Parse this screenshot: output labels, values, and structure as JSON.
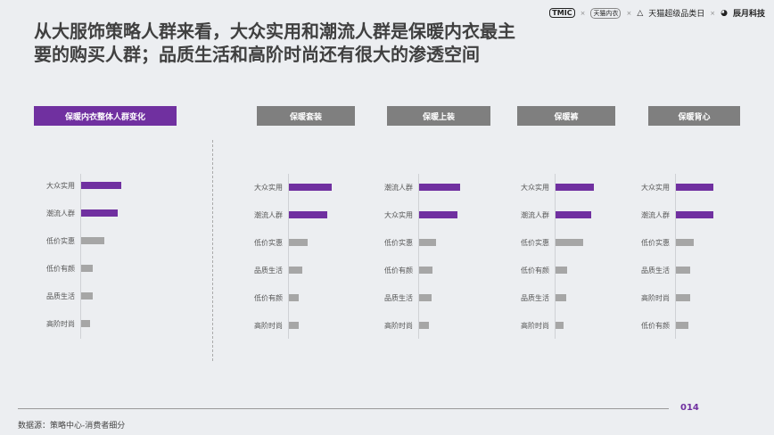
{
  "title_line1": "从大服饰策略人群来看，大众实用和潮流人群是保暖内衣最主",
  "title_line2": "要的购买人群；品质生活和高阶时尚还有很大的渗透空间",
  "logos": {
    "tmic": "TMIC",
    "brand1": "天猫内衣",
    "brand2": "天猫超级品类日",
    "brand3": "辰月科技",
    "sep": "×"
  },
  "page_number": "014",
  "source": "数据源：策略中心-消费者细分",
  "colors": {
    "highlight": "#7030a0",
    "normal": "#a6a6a6",
    "header_gray": "#7f7f7f"
  },
  "chart_data": [
    {
      "type": "bar",
      "title": "保暖内衣整体人群变化",
      "categories": [
        "大众实用",
        "潮流人群",
        "低价实惠",
        "低价有颜",
        "品质生活",
        "高阶时尚"
      ],
      "values": [
        45,
        41,
        26,
        13,
        13,
        10
      ],
      "highlight": [
        true,
        true,
        false,
        false,
        false,
        false
      ]
    },
    {
      "type": "bar",
      "title": "保暖套装",
      "categories": [
        "大众实用",
        "潮流人群",
        "低价实惠",
        "品质生活",
        "低价有颜",
        "高阶时尚"
      ],
      "values": [
        48,
        43,
        21,
        15,
        11,
        11
      ],
      "highlight": [
        true,
        true,
        false,
        false,
        false,
        false
      ]
    },
    {
      "type": "bar",
      "title": "保暖上装",
      "categories": [
        "潮流人群",
        "大众实用",
        "低价实惠",
        "低价有颜",
        "品质生活",
        "高阶时尚"
      ],
      "values": [
        46,
        43,
        19,
        15,
        14,
        11
      ],
      "highlight": [
        true,
        true,
        false,
        false,
        false,
        false
      ]
    },
    {
      "type": "bar",
      "title": "保暖裤",
      "categories": [
        "大众实用",
        "潮流人群",
        "低价实惠",
        "低价有颜",
        "品质生活",
        "高阶时尚"
      ],
      "values": [
        43,
        40,
        31,
        13,
        12,
        9
      ],
      "highlight": [
        true,
        true,
        false,
        false,
        false,
        false
      ]
    },
    {
      "type": "bar",
      "title": "保暖背心",
      "categories": [
        "大众实用",
        "潮流人群",
        "低价实惠",
        "品质生活",
        "高阶时尚",
        "低价有颜"
      ],
      "values": [
        42,
        42,
        20,
        16,
        16,
        14
      ],
      "highlight": [
        true,
        true,
        false,
        false,
        false,
        false
      ]
    }
  ]
}
